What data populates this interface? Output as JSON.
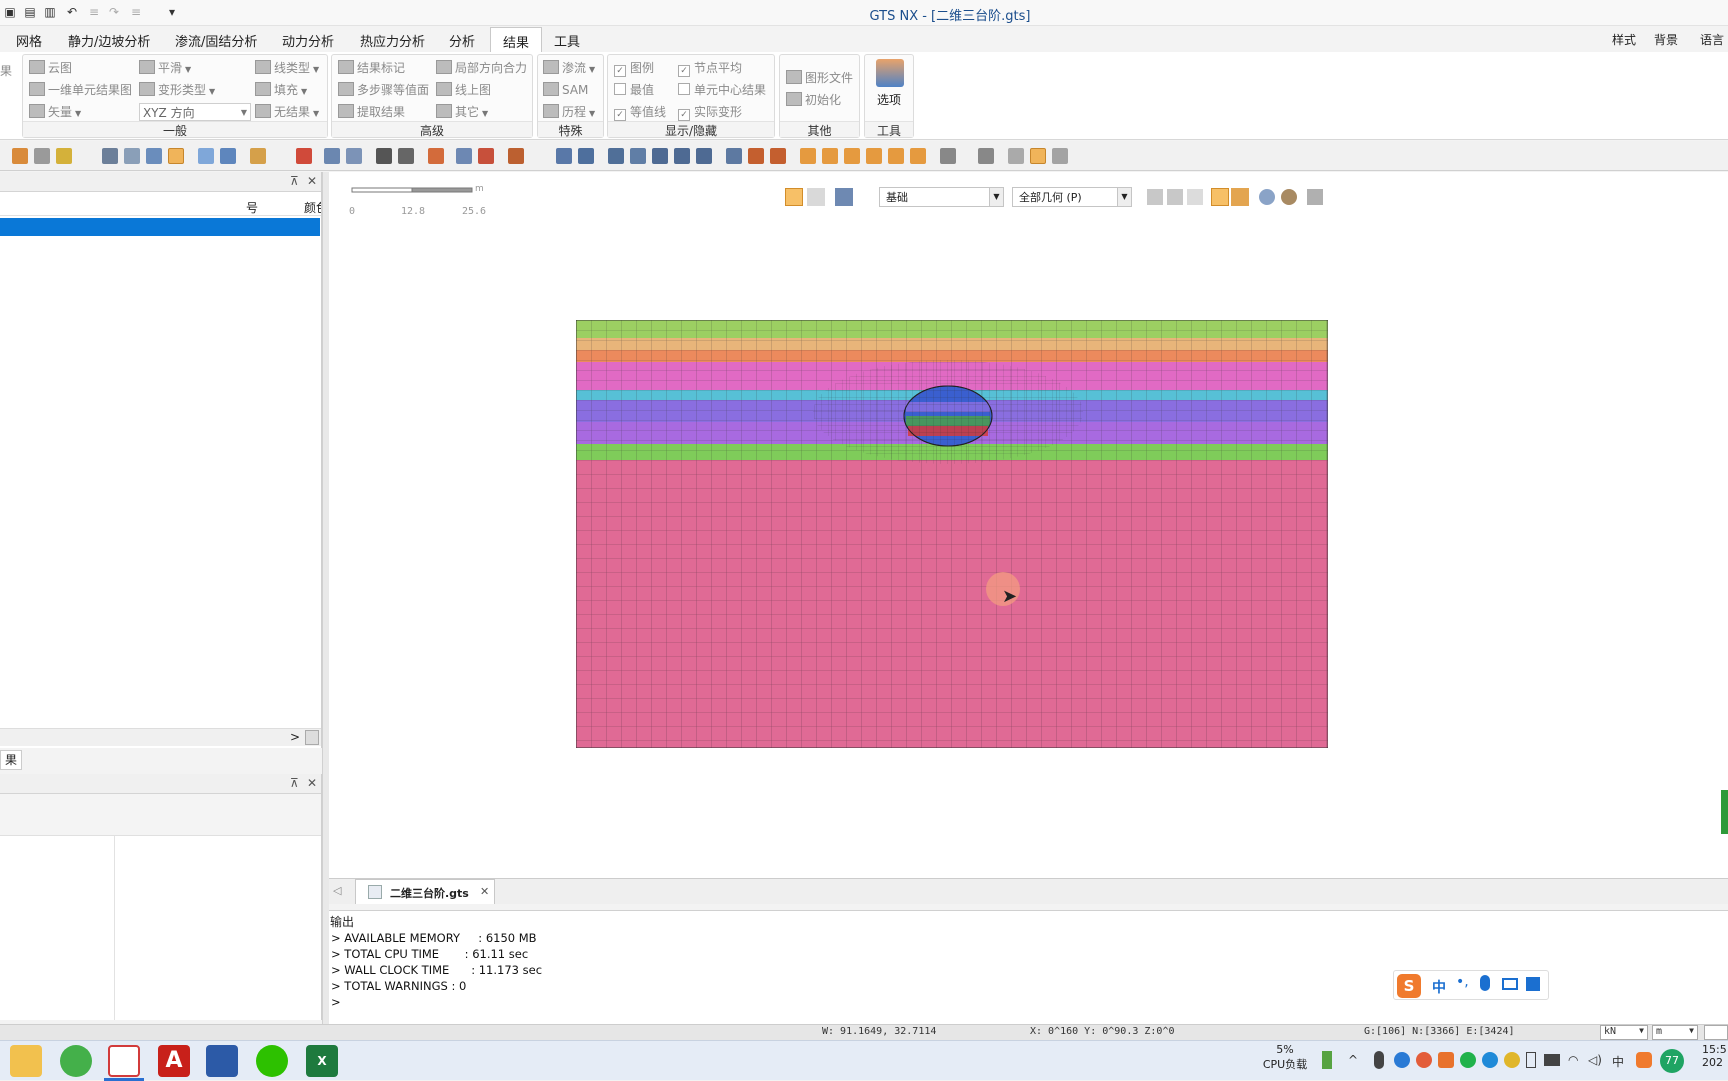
{
  "window": {
    "title": "GTS NX - [二维三台阶.gts]",
    "quick_access_dropdown": "▾"
  },
  "menu": {
    "tabs": [
      "网格",
      "静力/边坡分析",
      "渗流/固结分析",
      "动力分析",
      "热应力分析",
      "分析",
      "结果",
      "工具"
    ],
    "active_tab": "结果",
    "right_items": [
      "样式",
      "背景",
      "语言"
    ]
  },
  "ribbon": {
    "left_cut_labels": [
      "果"
    ],
    "general": {
      "title": "一般",
      "items": [
        "云图",
        "一维单元结果图",
        "矢量",
        "平滑",
        "变形类型",
        "XYZ 方向",
        "线类型",
        "填充",
        "无结果"
      ]
    },
    "advanced": {
      "title": "高级",
      "items": [
        "结果标记",
        "多步骤等值面",
        "提取结果",
        "局部方向合力",
        "线上图",
        "其它"
      ]
    },
    "special": {
      "title": "特殊",
      "items": [
        "渗流",
        "SAM",
        "历程"
      ]
    },
    "display": {
      "title": "显示/隐藏",
      "items": [
        {
          "label": "图例",
          "checked": true
        },
        {
          "label": "最值",
          "checked": false
        },
        {
          "label": "等值线",
          "checked": true
        },
        {
          "label": "节点平均",
          "checked": true
        },
        {
          "label": "单元中心结果",
          "checked": false
        },
        {
          "label": "实际变形",
          "checked": true
        }
      ]
    },
    "other": {
      "title": "其他",
      "items": [
        "图形文件",
        "初始化"
      ]
    },
    "tools": {
      "title": "工具",
      "items": [
        "选项"
      ]
    }
  },
  "left_panel": {
    "columns": [
      "号",
      "颜色"
    ],
    "bottom_tab": "果",
    "pin": "⊼",
    "close": "✕",
    "scroll_arrow": ">"
  },
  "viewport": {
    "scale_ticks": [
      "0",
      "12.8",
      "25.6"
    ],
    "scale_unit": "m",
    "filter_1": "基础",
    "filter_2": "全部几何 (P)"
  },
  "doc_tab": {
    "label": "二维三台阶.gts",
    "close": "✕"
  },
  "output": {
    "title": "输出",
    "lines": [
      "> AVAILABLE MEMORY     : 6150 MB",
      "> TOTAL CPU TIME       : 61.11 sec",
      "> WALL CLOCK TIME      : 11.173 sec",
      "> TOTAL WARNINGS : 0",
      ">"
    ]
  },
  "status": {
    "w": "W: 91.1649, 32.7114",
    "xyz": "X: 0^160 Y: 0^90.3 Z:0^0",
    "counts": "G:[106] N:[3366] E:[3424]",
    "unit_force": "kN",
    "unit_length": "m"
  },
  "ime": {
    "lang": "中"
  },
  "taskbar": {
    "cpu_pct": "5%",
    "cpu_label": "CPU负载",
    "ime_lang": "中",
    "badge": "77",
    "clock_time": "15:5",
    "clock_date": "202"
  },
  "colors": {
    "accent_blue": "#0a78d7",
    "mesh_green": "#9ccf62",
    "mesh_orange": "#e7a36a",
    "mesh_magenta": "#e16ac4",
    "mesh_cyan": "#57c0d6",
    "mesh_purple": "#8a6ee0",
    "mesh_pink": "#e06a95",
    "cursor_highlight": "#f5a080"
  }
}
